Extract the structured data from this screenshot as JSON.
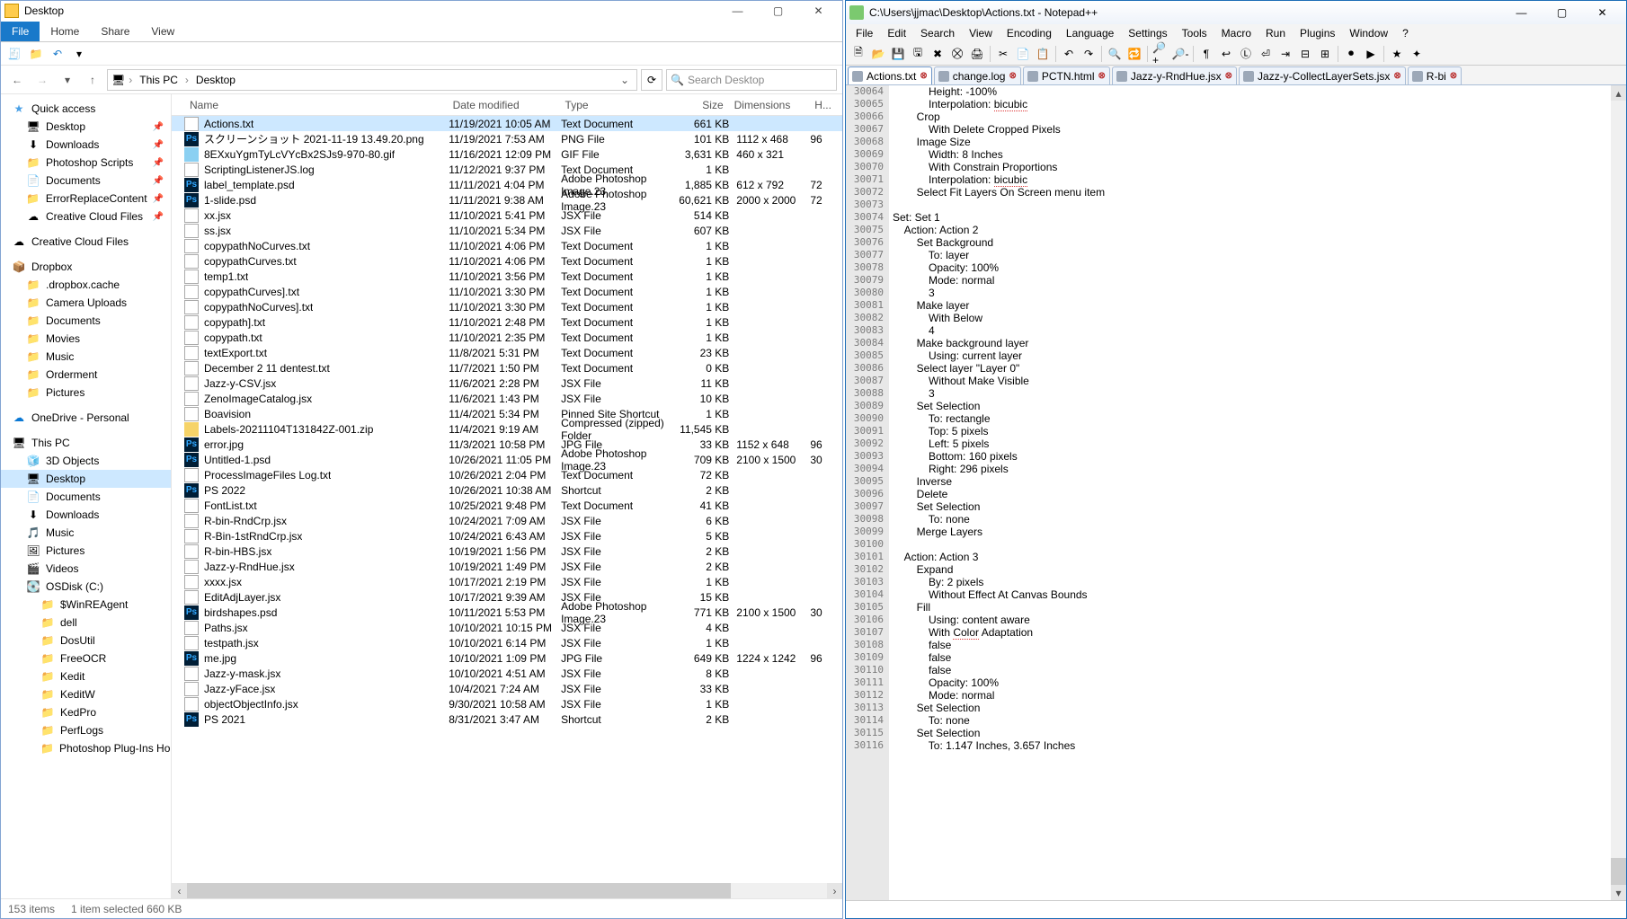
{
  "explorer": {
    "title": "Desktop",
    "win_min": "—",
    "win_max": "▢",
    "win_close": "✕",
    "tabs": {
      "file": "File",
      "home": "Home",
      "share": "Share",
      "view": "View"
    },
    "breadcrumb": {
      "root": "This PC",
      "leaf": "Desktop"
    },
    "refresh_glyph": "⟳",
    "search_placeholder": "Search Desktop",
    "columns": {
      "name": "Name",
      "date": "Date modified",
      "type": "Type",
      "size": "Size",
      "dim": "Dimensions",
      "h": "H..."
    },
    "nav": [
      {
        "kind": "header",
        "icon": "★",
        "cls": "fc-star",
        "label": "Quick access",
        "indent": 0
      },
      {
        "kind": "item",
        "icon": "🖥",
        "label": "Desktop",
        "indent": 1,
        "pin": true
      },
      {
        "kind": "item",
        "icon": "⬇",
        "label": "Downloads",
        "indent": 1,
        "pin": true
      },
      {
        "kind": "item",
        "icon": "📁",
        "label": "Photoshop Scripts",
        "indent": 1,
        "pin": true
      },
      {
        "kind": "item",
        "icon": "📄",
        "label": "Documents",
        "indent": 1,
        "pin": true
      },
      {
        "kind": "item",
        "icon": "📁",
        "label": "ErrorReplaceContent",
        "indent": 1,
        "pin": true
      },
      {
        "kind": "item",
        "icon": "☁",
        "label": "Creative Cloud Files",
        "indent": 1,
        "pin": true
      },
      {
        "kind": "spacer"
      },
      {
        "kind": "item",
        "icon": "☁",
        "label": "Creative Cloud Files",
        "indent": 0
      },
      {
        "kind": "spacer"
      },
      {
        "kind": "header",
        "icon": "📦",
        "label": "Dropbox",
        "indent": 0
      },
      {
        "kind": "item",
        "icon": "📁",
        "label": ".dropbox.cache",
        "indent": 1
      },
      {
        "kind": "item",
        "icon": "📁",
        "label": "Camera Uploads",
        "indent": 1
      },
      {
        "kind": "item",
        "icon": "📁",
        "label": "Documents",
        "indent": 1
      },
      {
        "kind": "item",
        "icon": "📁",
        "label": "Movies",
        "indent": 1
      },
      {
        "kind": "item",
        "icon": "📁",
        "label": "Music",
        "indent": 1
      },
      {
        "kind": "item",
        "icon": "📁",
        "label": "Orderment",
        "indent": 1
      },
      {
        "kind": "item",
        "icon": "📁",
        "label": "Pictures",
        "indent": 1
      },
      {
        "kind": "spacer"
      },
      {
        "kind": "item",
        "icon": "☁",
        "cls": "fc-onedrive",
        "label": "OneDrive - Personal",
        "indent": 0
      },
      {
        "kind": "spacer"
      },
      {
        "kind": "header",
        "icon": "🖥",
        "label": "This PC",
        "indent": 0
      },
      {
        "kind": "item",
        "icon": "🧊",
        "label": "3D Objects",
        "indent": 1
      },
      {
        "kind": "item",
        "icon": "🖥",
        "label": "Desktop",
        "indent": 1,
        "sel": true
      },
      {
        "kind": "item",
        "icon": "📄",
        "label": "Documents",
        "indent": 1
      },
      {
        "kind": "item",
        "icon": "⬇",
        "label": "Downloads",
        "indent": 1
      },
      {
        "kind": "item",
        "icon": "🎵",
        "label": "Music",
        "indent": 1
      },
      {
        "kind": "item",
        "icon": "🖼",
        "label": "Pictures",
        "indent": 1
      },
      {
        "kind": "item",
        "icon": "🎬",
        "label": "Videos",
        "indent": 1
      },
      {
        "kind": "item",
        "icon": "💽",
        "label": "OSDisk (C:)",
        "indent": 1
      },
      {
        "kind": "item",
        "icon": "📁",
        "label": "$WinREAgent",
        "indent": 2
      },
      {
        "kind": "item",
        "icon": "📁",
        "label": "dell",
        "indent": 2
      },
      {
        "kind": "item",
        "icon": "📁",
        "label": "DosUtil",
        "indent": 2
      },
      {
        "kind": "item",
        "icon": "📁",
        "label": "FreeOCR",
        "indent": 2
      },
      {
        "kind": "item",
        "icon": "📁",
        "label": "Kedit",
        "indent": 2
      },
      {
        "kind": "item",
        "icon": "📁",
        "label": "KeditW",
        "indent": 2
      },
      {
        "kind": "item",
        "icon": "📁",
        "label": "KedPro",
        "indent": 2
      },
      {
        "kind": "item",
        "icon": "📁",
        "label": "PerfLogs",
        "indent": 2
      },
      {
        "kind": "item",
        "icon": "📁",
        "label": "Photoshop  Plug-Ins Hold Are",
        "indent": 2
      }
    ],
    "files": [
      {
        "ic": "fc-txt",
        "name": "Actions.txt",
        "date": "11/19/2021 10:05 AM",
        "type": "Text Document",
        "size": "661 KB",
        "dim": "",
        "sel": true
      },
      {
        "ic": "fc-ps",
        "name": "スクリーンショット 2021-11-19 13.49.20.png",
        "date": "11/19/2021 7:53 AM",
        "type": "PNG File",
        "size": "101 KB",
        "dim": "1112 x 468",
        "h": "96"
      },
      {
        "ic": "fc-img",
        "name": "8EXxuYgmTyLcVYcBx2SJs9-970-80.gif",
        "date": "11/16/2021 12:09 PM",
        "type": "GIF File",
        "size": "3,631 KB",
        "dim": "460 x 321"
      },
      {
        "ic": "fc-txt",
        "name": "ScriptingListenerJS.log",
        "date": "11/12/2021 9:37 PM",
        "type": "Text Document",
        "size": "1 KB",
        "dim": ""
      },
      {
        "ic": "fc-ps",
        "name": "label_template.psd",
        "date": "11/11/2021 4:04 PM",
        "type": "Adobe Photoshop Image.23",
        "size": "1,885 KB",
        "dim": "612 x 792",
        "h": "72"
      },
      {
        "ic": "fc-ps",
        "name": "1-slide.psd",
        "date": "11/11/2021 9:38 AM",
        "type": "Adobe Photoshop Image.23",
        "size": "60,621 KB",
        "dim": "2000 x 2000",
        "h": "72"
      },
      {
        "ic": "fc-txt",
        "name": "xx.jsx",
        "date": "11/10/2021 5:41 PM",
        "type": "JSX File",
        "size": "514 KB",
        "dim": ""
      },
      {
        "ic": "fc-txt",
        "name": "ss.jsx",
        "date": "11/10/2021 5:34 PM",
        "type": "JSX File",
        "size": "607 KB",
        "dim": ""
      },
      {
        "ic": "fc-txt",
        "name": "copypathNoCurves.txt",
        "date": "11/10/2021 4:06 PM",
        "type": "Text Document",
        "size": "1 KB",
        "dim": ""
      },
      {
        "ic": "fc-txt",
        "name": "copypathCurves.txt",
        "date": "11/10/2021 4:06 PM",
        "type": "Text Document",
        "size": "1 KB",
        "dim": ""
      },
      {
        "ic": "fc-txt",
        "name": "temp1.txt",
        "date": "11/10/2021 3:56 PM",
        "type": "Text Document",
        "size": "1 KB",
        "dim": ""
      },
      {
        "ic": "fc-txt",
        "name": "copypathCurves].txt",
        "date": "11/10/2021 3:30 PM",
        "type": "Text Document",
        "size": "1 KB",
        "dim": ""
      },
      {
        "ic": "fc-txt",
        "name": "copypathNoCurves].txt",
        "date": "11/10/2021 3:30 PM",
        "type": "Text Document",
        "size": "1 KB",
        "dim": ""
      },
      {
        "ic": "fc-txt",
        "name": "copypath].txt",
        "date": "11/10/2021 2:48 PM",
        "type": "Text Document",
        "size": "1 KB",
        "dim": ""
      },
      {
        "ic": "fc-txt",
        "name": "copypath.txt",
        "date": "11/10/2021 2:35 PM",
        "type": "Text Document",
        "size": "1 KB",
        "dim": ""
      },
      {
        "ic": "fc-txt",
        "name": "textExport.txt",
        "date": "11/8/2021 5:31 PM",
        "type": "Text Document",
        "size": "23 KB",
        "dim": ""
      },
      {
        "ic": "fc-txt",
        "name": "December 2 11 dentest.txt",
        "date": "11/7/2021 1:50 PM",
        "type": "Text Document",
        "size": "0 KB",
        "dim": ""
      },
      {
        "ic": "fc-txt",
        "name": "Jazz-y-CSV.jsx",
        "date": "11/6/2021 2:28 PM",
        "type": "JSX File",
        "size": "11 KB",
        "dim": ""
      },
      {
        "ic": "fc-txt",
        "name": "ZenoImageCatalog.jsx",
        "date": "11/6/2021 1:43 PM",
        "type": "JSX File",
        "size": "10 KB",
        "dim": ""
      },
      {
        "ic": "fc-txt",
        "name": "Boavision",
        "date": "11/4/2021 5:34 PM",
        "type": "Pinned Site Shortcut",
        "size": "1 KB",
        "dim": ""
      },
      {
        "ic": "fc-zip",
        "name": "Labels-20211104T131842Z-001.zip",
        "date": "11/4/2021 9:19 AM",
        "type": "Compressed (zipped) Folder",
        "size": "11,545 KB",
        "dim": ""
      },
      {
        "ic": "fc-ps",
        "name": "error.jpg",
        "date": "11/3/2021 10:58 PM",
        "type": "JPG File",
        "size": "33 KB",
        "dim": "1152 x 648",
        "h": "96"
      },
      {
        "ic": "fc-ps",
        "name": "Untitled-1.psd",
        "date": "10/26/2021 11:05 PM",
        "type": "Adobe Photoshop Image.23",
        "size": "709 KB",
        "dim": "2100 x 1500",
        "h": "30"
      },
      {
        "ic": "fc-txt",
        "name": "ProcessImageFiles Log.txt",
        "date": "10/26/2021 2:04 PM",
        "type": "Text Document",
        "size": "72 KB",
        "dim": ""
      },
      {
        "ic": "fc-ps",
        "name": "PS 2022",
        "date": "10/26/2021 10:38 AM",
        "type": "Shortcut",
        "size": "2 KB",
        "dim": ""
      },
      {
        "ic": "fc-txt",
        "name": "FontList.txt",
        "date": "10/25/2021 9:48 PM",
        "type": "Text Document",
        "size": "41 KB",
        "dim": ""
      },
      {
        "ic": "fc-txt",
        "name": "R-bin-RndCrp.jsx",
        "date": "10/24/2021 7:09 AM",
        "type": "JSX File",
        "size": "6 KB",
        "dim": ""
      },
      {
        "ic": "fc-txt",
        "name": "R-Bin-1stRndCrp.jsx",
        "date": "10/24/2021 6:43 AM",
        "type": "JSX File",
        "size": "5 KB",
        "dim": ""
      },
      {
        "ic": "fc-txt",
        "name": "R-bin-HBS.jsx",
        "date": "10/19/2021 1:56 PM",
        "type": "JSX File",
        "size": "2 KB",
        "dim": ""
      },
      {
        "ic": "fc-txt",
        "name": "Jazz-y-RndHue.jsx",
        "date": "10/19/2021 1:49 PM",
        "type": "JSX File",
        "size": "2 KB",
        "dim": ""
      },
      {
        "ic": "fc-txt",
        "name": "xxxx.jsx",
        "date": "10/17/2021 2:19 PM",
        "type": "JSX File",
        "size": "1 KB",
        "dim": ""
      },
      {
        "ic": "fc-txt",
        "name": "EditAdjLayer.jsx",
        "date": "10/17/2021 9:39 AM",
        "type": "JSX File",
        "size": "15 KB",
        "dim": ""
      },
      {
        "ic": "fc-ps",
        "name": "birdshapes.psd",
        "date": "10/11/2021 5:53 PM",
        "type": "Adobe Photoshop Image.23",
        "size": "771 KB",
        "dim": "2100 x 1500",
        "h": "30"
      },
      {
        "ic": "fc-txt",
        "name": "Paths.jsx",
        "date": "10/10/2021 10:15 PM",
        "type": "JSX File",
        "size": "4 KB",
        "dim": ""
      },
      {
        "ic": "fc-txt",
        "name": "testpath.jsx",
        "date": "10/10/2021 6:14 PM",
        "type": "JSX File",
        "size": "1 KB",
        "dim": ""
      },
      {
        "ic": "fc-ps",
        "name": "me.jpg",
        "date": "10/10/2021 1:09 PM",
        "type": "JPG File",
        "size": "649 KB",
        "dim": "1224 x 1242",
        "h": "96"
      },
      {
        "ic": "fc-txt",
        "name": "Jazz-y-mask.jsx",
        "date": "10/10/2021 4:51 AM",
        "type": "JSX File",
        "size": "8 KB",
        "dim": ""
      },
      {
        "ic": "fc-txt",
        "name": "Jazz-yFace.jsx",
        "date": "10/4/2021 7:24 AM",
        "type": "JSX File",
        "size": "33 KB",
        "dim": ""
      },
      {
        "ic": "fc-txt",
        "name": "objectObjectInfo.jsx",
        "date": "9/30/2021 10:58 AM",
        "type": "JSX File",
        "size": "1 KB",
        "dim": ""
      },
      {
        "ic": "fc-ps",
        "name": "PS 2021",
        "date": "8/31/2021 3:47 AM",
        "type": "Shortcut",
        "size": "2 KB",
        "dim": ""
      }
    ],
    "status": {
      "items": "153 items",
      "sel": "1 item selected  660 KB"
    }
  },
  "npp": {
    "title": "C:\\Users\\jjmac\\Desktop\\Actions.txt - Notepad++",
    "win_min": "—",
    "win_max": "▢",
    "win_close": "✕",
    "menu": [
      "File",
      "Edit",
      "Search",
      "View",
      "Encoding",
      "Language",
      "Settings",
      "Tools",
      "Macro",
      "Run",
      "Plugins",
      "Window",
      "?"
    ],
    "toolbar_icons": [
      "new",
      "open",
      "save",
      "save-all",
      "close",
      "close-all",
      "print",
      "|",
      "cut",
      "copy",
      "paste",
      "|",
      "undo",
      "redo",
      "|",
      "find",
      "replace",
      "|",
      "zoom-in",
      "zoom-out",
      "|",
      "ws",
      "wrap",
      "lang",
      "eol",
      "indent",
      "fold",
      "unfold",
      "|",
      "rec",
      "play",
      "|",
      "fx1",
      "fx2"
    ],
    "tabs": [
      {
        "label": "Actions.txt",
        "active": true
      },
      {
        "label": "change.log",
        "active": false
      },
      {
        "label": "PCTN.html",
        "active": false
      },
      {
        "label": "Jazz-y-RndHue.jsx",
        "active": false
      },
      {
        "label": "Jazz-y-CollectLayerSets.jsx",
        "active": false
      },
      {
        "label": "R-bi",
        "active": false
      }
    ],
    "gutter_start": 30064,
    "code_lines": [
      "            Height: -100%",
      "            Interpolation: bicubic",
      "        Crop",
      "            With Delete Cropped Pixels",
      "        Image Size",
      "            Width: 8 Inches",
      "            With Constrain Proportions",
      "            Interpolation: bicubic",
      "        Select Fit Layers On Screen menu item",
      "",
      "Set: Set 1",
      "    Action: Action 2",
      "        Set Background",
      "            To: layer",
      "            Opacity: 100%",
      "            Mode: normal",
      "            3",
      "        Make layer",
      "            With Below",
      "            4",
      "        Make background layer",
      "            Using: current layer",
      "        Select layer \"Layer 0\"",
      "            Without Make Visible",
      "            3",
      "        Set Selection",
      "            To: rectangle",
      "            Top: 5 pixels",
      "            Left: 5 pixels",
      "            Bottom: 160 pixels",
      "            Right: 296 pixels",
      "        Inverse",
      "        Delete",
      "        Set Selection",
      "            To: none",
      "        Merge Layers",
      "",
      "    Action: Action 3",
      "        Expand",
      "            By: 2 pixels",
      "            Without Effect At Canvas Bounds",
      "        Fill",
      "            Using: content aware",
      "            With Color Adaptation",
      "            false",
      "            false",
      "            false",
      "            Opacity: 100%",
      "            Mode: normal",
      "        Set Selection",
      "            To: none",
      "        Set Selection",
      "            To: 1.147 Inches, 3.657 Inches"
    ]
  }
}
